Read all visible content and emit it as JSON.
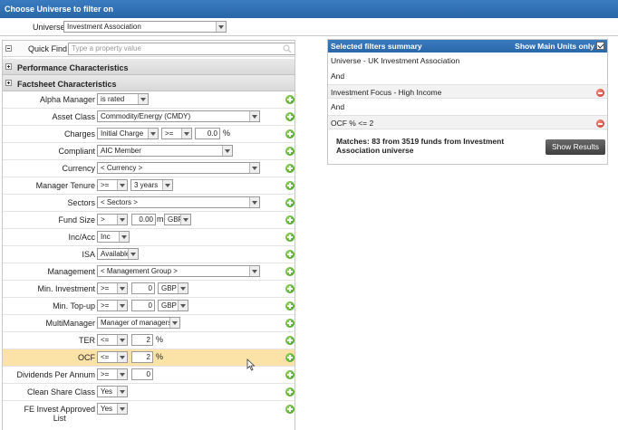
{
  "header": {
    "title": "Choose Universe to filter on"
  },
  "universe": {
    "label": "Universe",
    "value": "Investment Association"
  },
  "quick_find": {
    "label": "Quick Find",
    "placeholder": "Type a property value"
  },
  "sections": [
    {
      "label": "Performance Characteristics"
    },
    {
      "label": "Factsheet Characteristics"
    }
  ],
  "filters": {
    "alpha_manager": {
      "label": "Alpha Manager",
      "op": "is rated"
    },
    "asset_class": {
      "label": "Asset Class",
      "value": "Commodity/Energy (CMDY)"
    },
    "charges": {
      "label": "Charges",
      "type": "Initial Charge",
      "op": ">=",
      "value": "0.0",
      "unit": "%"
    },
    "compliant": {
      "label": "Compliant",
      "value": "AIC Member"
    },
    "currency": {
      "label": "Currency",
      "value": "< Currency >"
    },
    "manager_tenure": {
      "label": "Manager Tenure",
      "op": ">=",
      "value": "3 years"
    },
    "sectors": {
      "label": "Sectors",
      "value": "< Sectors >"
    },
    "fund_size": {
      "label": "Fund Size",
      "op": ">",
      "value": "0.00",
      "unit": "m",
      "currency": "GBP"
    },
    "inc_acc": {
      "label": "Inc/Acc",
      "value": "Inc"
    },
    "isa": {
      "label": "ISA",
      "value": "Available"
    },
    "management": {
      "label": "Management",
      "value": "< Management Group >"
    },
    "min_investment": {
      "label": "Min. Investment",
      "op": ">=",
      "value": "0",
      "currency": "GBP"
    },
    "min_topup": {
      "label": "Min. Top-up",
      "op": ">=",
      "value": "0",
      "currency": "GBP"
    },
    "multimanager": {
      "label": "MultiManager",
      "value": "Manager of managers"
    },
    "ter": {
      "label": "TER",
      "op": "<=",
      "value": "2",
      "unit": "%"
    },
    "ocf": {
      "label": "OCF",
      "op": "<=",
      "value": "2",
      "unit": "%"
    },
    "dividends": {
      "label": "Dividends Per Annum",
      "op": ">=",
      "value": "0"
    },
    "clean_share": {
      "label": "Clean Share Class",
      "value": "Yes"
    },
    "fe_invest": {
      "label_line1": "FE Invest Approved",
      "label_line2": "List",
      "value": "Yes"
    }
  },
  "summary": {
    "title": "Selected filters summary",
    "units_label": "Show Main Units only",
    "lines": [
      "Universe - UK Investment Association",
      "And",
      "Investment Focus - High Income",
      "And",
      "OCF % <= 2"
    ],
    "matches": "Matches: 83 from 3519 funds from Investment Association universe",
    "button": "Show Results"
  },
  "colors": {
    "header_blue": "#2f6fb1",
    "highlight": "#fbe3a7",
    "add_green": "#4caf2a",
    "remove_red": "#d9443a"
  }
}
